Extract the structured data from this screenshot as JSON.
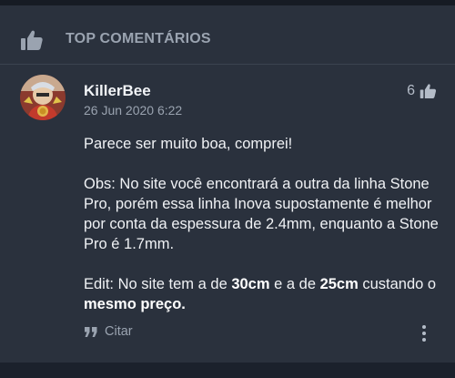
{
  "header": {
    "title": "TOP COMENTÁRIOS",
    "icon": "thumbs-up-icon"
  },
  "comment": {
    "author": "KillerBee",
    "timestamp": "26 Jun 2020 6:22",
    "likes": "6",
    "paragraph1": "Parece ser muito boa, comprei!",
    "paragraph2": "Obs: No site você encontrará a outra da linha Stone Pro, porém essa linha Inova supostamente é melhor por conta da espessura de 2.4mm, enquanto a Stone Pro é 1.7mm.",
    "paragraph3": {
      "t1": "Edit: No site tem a de ",
      "b1": "30cm",
      "t2": " e a de ",
      "b2": "25cm",
      "t3": " custando o ",
      "b3": "mesmo preço."
    }
  },
  "actions": {
    "quote_label": "Citar"
  },
  "colors": {
    "page_background": "#1b212c",
    "card_background": "#2a313d",
    "muted_text": "#9aa3b0",
    "primary_text": "#f0f2f5"
  }
}
